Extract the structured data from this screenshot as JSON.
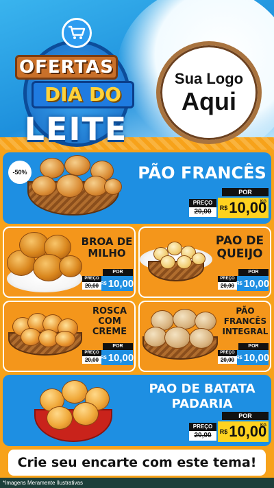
{
  "header": {
    "title_line1": "OFERTAS",
    "title_line2": "DIA DO",
    "title_line3": "LEITE",
    "logo_line1": "Sua Logo",
    "logo_line2": "Aqui"
  },
  "labels": {
    "por": "POR",
    "preco": "PREÇO",
    "currency": "R$",
    "unit": "KG"
  },
  "products": [
    {
      "name_line1": "PÃO FRANCÊS",
      "name_line2": "",
      "name_line3": "",
      "old_price": "20,00",
      "new_price": "10,00",
      "discount": "-50%"
    },
    {
      "name_line1": "BROA DE",
      "name_line2": "MILHO",
      "name_line3": "",
      "old_price": "20,00",
      "new_price": "10,00"
    },
    {
      "name_line1": "PAO DE",
      "name_line2": "QUEIJO",
      "name_line3": "",
      "old_price": "20,00",
      "new_price": "10,00"
    },
    {
      "name_line1": "ROSCA",
      "name_line2": "COM",
      "name_line3": "CREME",
      "old_price": "20,00",
      "new_price": "10,00"
    },
    {
      "name_line1": "PÃO",
      "name_line2": "FRANCÊS",
      "name_line3": "INTEGRAL",
      "old_price": "20,00",
      "new_price": "10,00"
    },
    {
      "name_line1": "PAO DE BATATA",
      "name_line2": "PADARIA",
      "name_line3": "",
      "old_price": "20,00",
      "new_price": "10,00"
    }
  ],
  "banner": {
    "text": "Crie seu encarte com este tema!"
  },
  "footer": {
    "disclaimer": "*Imagens Meramente Ilustrativas"
  },
  "colors": {
    "accent_blue": "#1e8fe2",
    "accent_orange": "#f4961b",
    "price_yellow": "#ffd21f"
  },
  "icons": [
    "shopping-cart-icon"
  ]
}
